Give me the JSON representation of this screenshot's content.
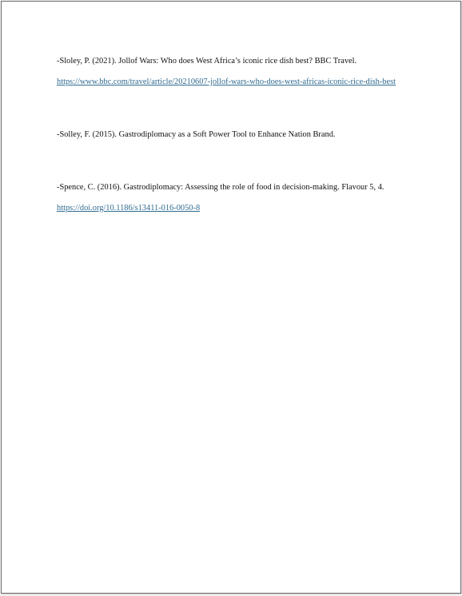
{
  "references": [
    {
      "text": "-Sloley, P. (2021). Jollof Wars: Who does West Africa’s iconic rice dish best? BBC Travel.",
      "link": "https://www.bbc.com/travel/article/20210607-jollof-wars-who-does-west-africas-iconic-rice-dish-best"
    },
    {
      "text": "-Solley, F. (2015). Gastrodiplomacy as a Soft Power Tool to Enhance Nation Brand.",
      "link": ""
    },
    {
      "text": "-Spence, C. (2016). Gastrodiplomacy: Assessing the role of food in decision-making. Flavour 5, 4.",
      "link": "https://doi.org/10.1186/s13411-016-0050-8"
    }
  ],
  "colors": {
    "link": "#2f6b91",
    "text": "#111111",
    "page_border": "#6b6b6b"
  }
}
